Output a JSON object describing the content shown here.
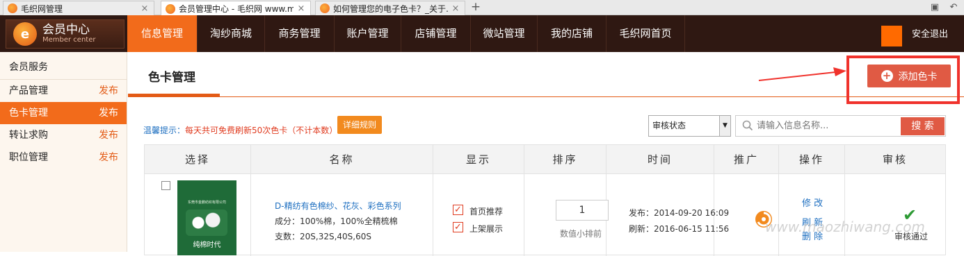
{
  "browser": {
    "tabs": [
      {
        "title": "毛织网管理",
        "close": "×"
      },
      {
        "title": "会员管理中心 - 毛织网 www.m",
        "close": "×"
      },
      {
        "title": "如何管理您的电子色卡？_关于…",
        "close": "×"
      }
    ],
    "new_tab": "+"
  },
  "header": {
    "logo_main": "会员中心",
    "logo_sub": "Member center",
    "nav": [
      "信息管理",
      "淘纱商城",
      "商务管理",
      "账户管理",
      "店铺管理",
      "微站管理",
      "我的店铺",
      "毛织网首页"
    ],
    "active_nav": "信息管理",
    "logout": "安全退出"
  },
  "sidebar": {
    "title": "会员服务",
    "items": [
      {
        "label": "产品管理",
        "action": "发布"
      },
      {
        "label": "色卡管理",
        "action": "发布"
      },
      {
        "label": "转让求购",
        "action": "发布"
      },
      {
        "label": "职位管理",
        "action": "发布"
      }
    ]
  },
  "main": {
    "title": "色卡管理",
    "add_button": "添加色卡",
    "tip_label": "温馨提示：",
    "tip_text": "每天共可免费刷新50次色卡（不计本数）",
    "rules_button": "详细规则",
    "status_select": "审核状态",
    "search_placeholder": "请输入信息名称...",
    "search_button": "搜 索"
  },
  "table": {
    "headers": [
      "选择",
      "名称",
      "显示",
      "排序",
      "时间",
      "推广",
      "操作",
      "审核"
    ],
    "row": {
      "thumb_company": "东莞市金鹏纺织有限公司",
      "thumb_caption": "纯棉时代",
      "name": "D-精纺有色棉纱、花灰、彩色系列",
      "composition": "成分：100%棉，100%全精梳棉",
      "count": "支数：20S,32S,40S,60S",
      "display_options": [
        "首页推荐",
        "上架展示"
      ],
      "sort_value": "1",
      "sort_note": "数值小排前",
      "published": "发布：2014-09-20 16:09",
      "refreshed": "刷新：2016-06-15 11:56",
      "ops": [
        "修 改",
        "刷 新",
        "删 除"
      ],
      "audit": "审核通过"
    }
  },
  "colors": {
    "accent": "#f26b1b",
    "nav_bg": "#2f1812",
    "button_red": "#e05a44",
    "link_blue": "#1e6fc0",
    "highlight_box": "#f0322c"
  },
  "watermark": "www.maozhiwang.com"
}
